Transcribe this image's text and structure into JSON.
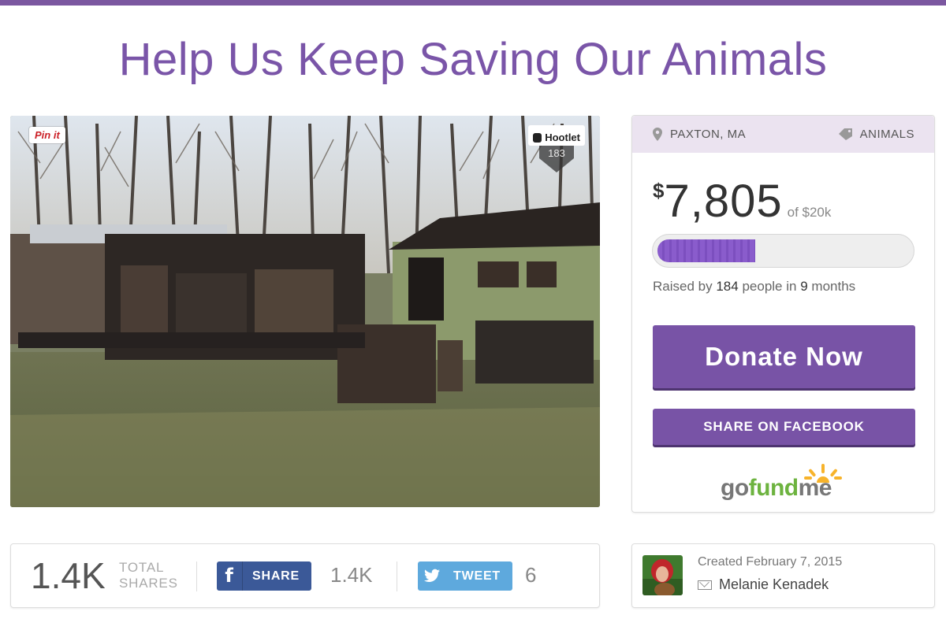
{
  "campaign": {
    "title": "Help Us Keep Saving Our Animals"
  },
  "photo": {
    "pin_label": "Pin it",
    "hootlet_label": "Hootlet",
    "hootlet_count": "183"
  },
  "sidebar": {
    "location": "PAXTON, MA",
    "category": "ANIMALS",
    "currency_symbol": "$",
    "raised_amount": "7,805",
    "goal_text": "of $20k",
    "progress_fraction": 0.39,
    "raised_prefix": "Raised by",
    "donor_count": "184",
    "raised_middle": "people in",
    "duration_count": "9",
    "duration_unit": "months",
    "donate_label": "Donate Now",
    "share_facebook_label": "SHARE ON FACEBOOK",
    "logo": {
      "go": "go",
      "fund": "fund",
      "me": "me"
    }
  },
  "shares": {
    "total": "1.4K",
    "total_label_line1": "TOTAL",
    "total_label_line2": "SHARES",
    "facebook_label": "SHARE",
    "facebook_count": "1.4K",
    "twitter_label": "TWEET",
    "twitter_count": "6"
  },
  "creator": {
    "created_text": "Created February 7, 2015",
    "name": "Melanie Kenadek"
  },
  "colors": {
    "brand_purple": "#7a55a8",
    "button_purple": "#7853a6",
    "facebook_blue": "#3b5998",
    "twitter_blue": "#5ea9dd",
    "gofundme_green": "#6db33f"
  },
  "icons": [
    "map-pin-icon",
    "tag-icon",
    "facebook-f-icon",
    "twitter-bird-icon",
    "mail-icon",
    "sun-rays-icon"
  ]
}
